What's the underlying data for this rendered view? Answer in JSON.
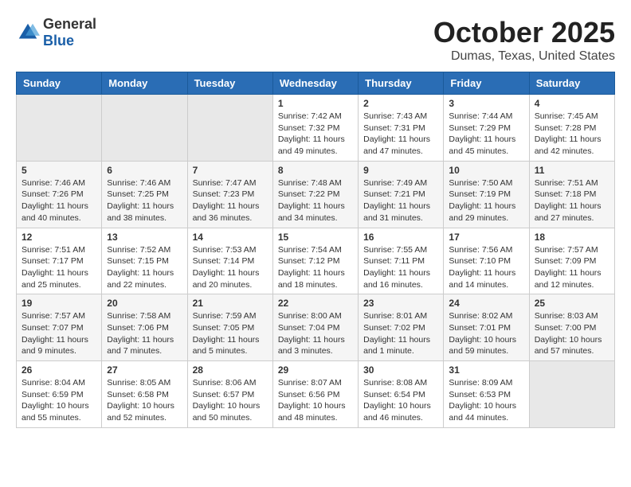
{
  "header": {
    "logo_general": "General",
    "logo_blue": "Blue",
    "month_title": "October 2025",
    "location": "Dumas, Texas, United States"
  },
  "days_of_week": [
    "Sunday",
    "Monday",
    "Tuesday",
    "Wednesday",
    "Thursday",
    "Friday",
    "Saturday"
  ],
  "weeks": [
    [
      {
        "day": "",
        "content": ""
      },
      {
        "day": "",
        "content": ""
      },
      {
        "day": "",
        "content": ""
      },
      {
        "day": "1",
        "content": "Sunrise: 7:42 AM\nSunset: 7:32 PM\nDaylight: 11 hours and 49 minutes."
      },
      {
        "day": "2",
        "content": "Sunrise: 7:43 AM\nSunset: 7:31 PM\nDaylight: 11 hours and 47 minutes."
      },
      {
        "day": "3",
        "content": "Sunrise: 7:44 AM\nSunset: 7:29 PM\nDaylight: 11 hours and 45 minutes."
      },
      {
        "day": "4",
        "content": "Sunrise: 7:45 AM\nSunset: 7:28 PM\nDaylight: 11 hours and 42 minutes."
      }
    ],
    [
      {
        "day": "5",
        "content": "Sunrise: 7:46 AM\nSunset: 7:26 PM\nDaylight: 11 hours and 40 minutes."
      },
      {
        "day": "6",
        "content": "Sunrise: 7:46 AM\nSunset: 7:25 PM\nDaylight: 11 hours and 38 minutes."
      },
      {
        "day": "7",
        "content": "Sunrise: 7:47 AM\nSunset: 7:23 PM\nDaylight: 11 hours and 36 minutes."
      },
      {
        "day": "8",
        "content": "Sunrise: 7:48 AM\nSunset: 7:22 PM\nDaylight: 11 hours and 34 minutes."
      },
      {
        "day": "9",
        "content": "Sunrise: 7:49 AM\nSunset: 7:21 PM\nDaylight: 11 hours and 31 minutes."
      },
      {
        "day": "10",
        "content": "Sunrise: 7:50 AM\nSunset: 7:19 PM\nDaylight: 11 hours and 29 minutes."
      },
      {
        "day": "11",
        "content": "Sunrise: 7:51 AM\nSunset: 7:18 PM\nDaylight: 11 hours and 27 minutes."
      }
    ],
    [
      {
        "day": "12",
        "content": "Sunrise: 7:51 AM\nSunset: 7:17 PM\nDaylight: 11 hours and 25 minutes."
      },
      {
        "day": "13",
        "content": "Sunrise: 7:52 AM\nSunset: 7:15 PM\nDaylight: 11 hours and 22 minutes."
      },
      {
        "day": "14",
        "content": "Sunrise: 7:53 AM\nSunset: 7:14 PM\nDaylight: 11 hours and 20 minutes."
      },
      {
        "day": "15",
        "content": "Sunrise: 7:54 AM\nSunset: 7:12 PM\nDaylight: 11 hours and 18 minutes."
      },
      {
        "day": "16",
        "content": "Sunrise: 7:55 AM\nSunset: 7:11 PM\nDaylight: 11 hours and 16 minutes."
      },
      {
        "day": "17",
        "content": "Sunrise: 7:56 AM\nSunset: 7:10 PM\nDaylight: 11 hours and 14 minutes."
      },
      {
        "day": "18",
        "content": "Sunrise: 7:57 AM\nSunset: 7:09 PM\nDaylight: 11 hours and 12 minutes."
      }
    ],
    [
      {
        "day": "19",
        "content": "Sunrise: 7:57 AM\nSunset: 7:07 PM\nDaylight: 11 hours and 9 minutes."
      },
      {
        "day": "20",
        "content": "Sunrise: 7:58 AM\nSunset: 7:06 PM\nDaylight: 11 hours and 7 minutes."
      },
      {
        "day": "21",
        "content": "Sunrise: 7:59 AM\nSunset: 7:05 PM\nDaylight: 11 hours and 5 minutes."
      },
      {
        "day": "22",
        "content": "Sunrise: 8:00 AM\nSunset: 7:04 PM\nDaylight: 11 hours and 3 minutes."
      },
      {
        "day": "23",
        "content": "Sunrise: 8:01 AM\nSunset: 7:02 PM\nDaylight: 11 hours and 1 minute."
      },
      {
        "day": "24",
        "content": "Sunrise: 8:02 AM\nSunset: 7:01 PM\nDaylight: 10 hours and 59 minutes."
      },
      {
        "day": "25",
        "content": "Sunrise: 8:03 AM\nSunset: 7:00 PM\nDaylight: 10 hours and 57 minutes."
      }
    ],
    [
      {
        "day": "26",
        "content": "Sunrise: 8:04 AM\nSunset: 6:59 PM\nDaylight: 10 hours and 55 minutes."
      },
      {
        "day": "27",
        "content": "Sunrise: 8:05 AM\nSunset: 6:58 PM\nDaylight: 10 hours and 52 minutes."
      },
      {
        "day": "28",
        "content": "Sunrise: 8:06 AM\nSunset: 6:57 PM\nDaylight: 10 hours and 50 minutes."
      },
      {
        "day": "29",
        "content": "Sunrise: 8:07 AM\nSunset: 6:56 PM\nDaylight: 10 hours and 48 minutes."
      },
      {
        "day": "30",
        "content": "Sunrise: 8:08 AM\nSunset: 6:54 PM\nDaylight: 10 hours and 46 minutes."
      },
      {
        "day": "31",
        "content": "Sunrise: 8:09 AM\nSunset: 6:53 PM\nDaylight: 10 hours and 44 minutes."
      },
      {
        "day": "",
        "content": ""
      }
    ]
  ]
}
